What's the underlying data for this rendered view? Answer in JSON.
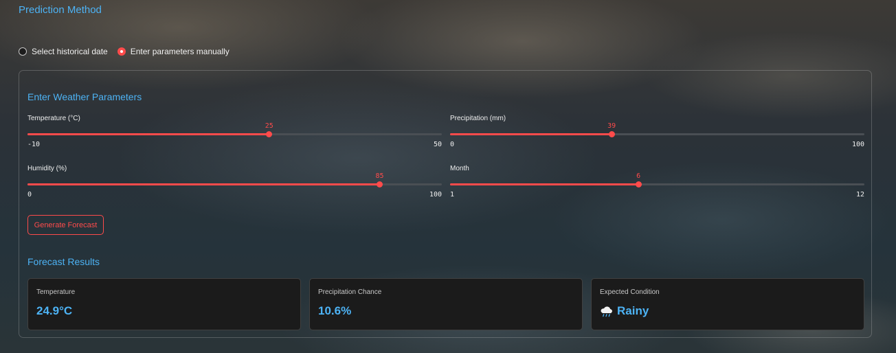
{
  "prediction": {
    "title": "Prediction Method",
    "options": [
      {
        "label": "Select historical date",
        "selected": false
      },
      {
        "label": "Enter parameters manually",
        "selected": true
      }
    ]
  },
  "params": {
    "title": "Enter Weather Parameters",
    "sliders": [
      {
        "label": "Temperature (°C)",
        "min": "-10",
        "max": "50",
        "value": "25"
      },
      {
        "label": "Precipitation (mm)",
        "min": "0",
        "max": "100",
        "value": "39"
      },
      {
        "label": "Humidity (%)",
        "min": "0",
        "max": "100",
        "value": "85"
      },
      {
        "label": "Month",
        "min": "1",
        "max": "12",
        "value": "6"
      }
    ],
    "button_label": "Generate Forecast"
  },
  "results": {
    "title": "Forecast Results",
    "cards": [
      {
        "label": "Temperature",
        "value": "24.9°C"
      },
      {
        "label": "Precipitation Chance",
        "value": "10.6%"
      },
      {
        "label": "Expected Condition",
        "value": "Rainy",
        "icon": "rain-cloud-icon"
      }
    ]
  },
  "colors": {
    "accent": "#ff4b4b",
    "heading": "#4db3f5"
  }
}
